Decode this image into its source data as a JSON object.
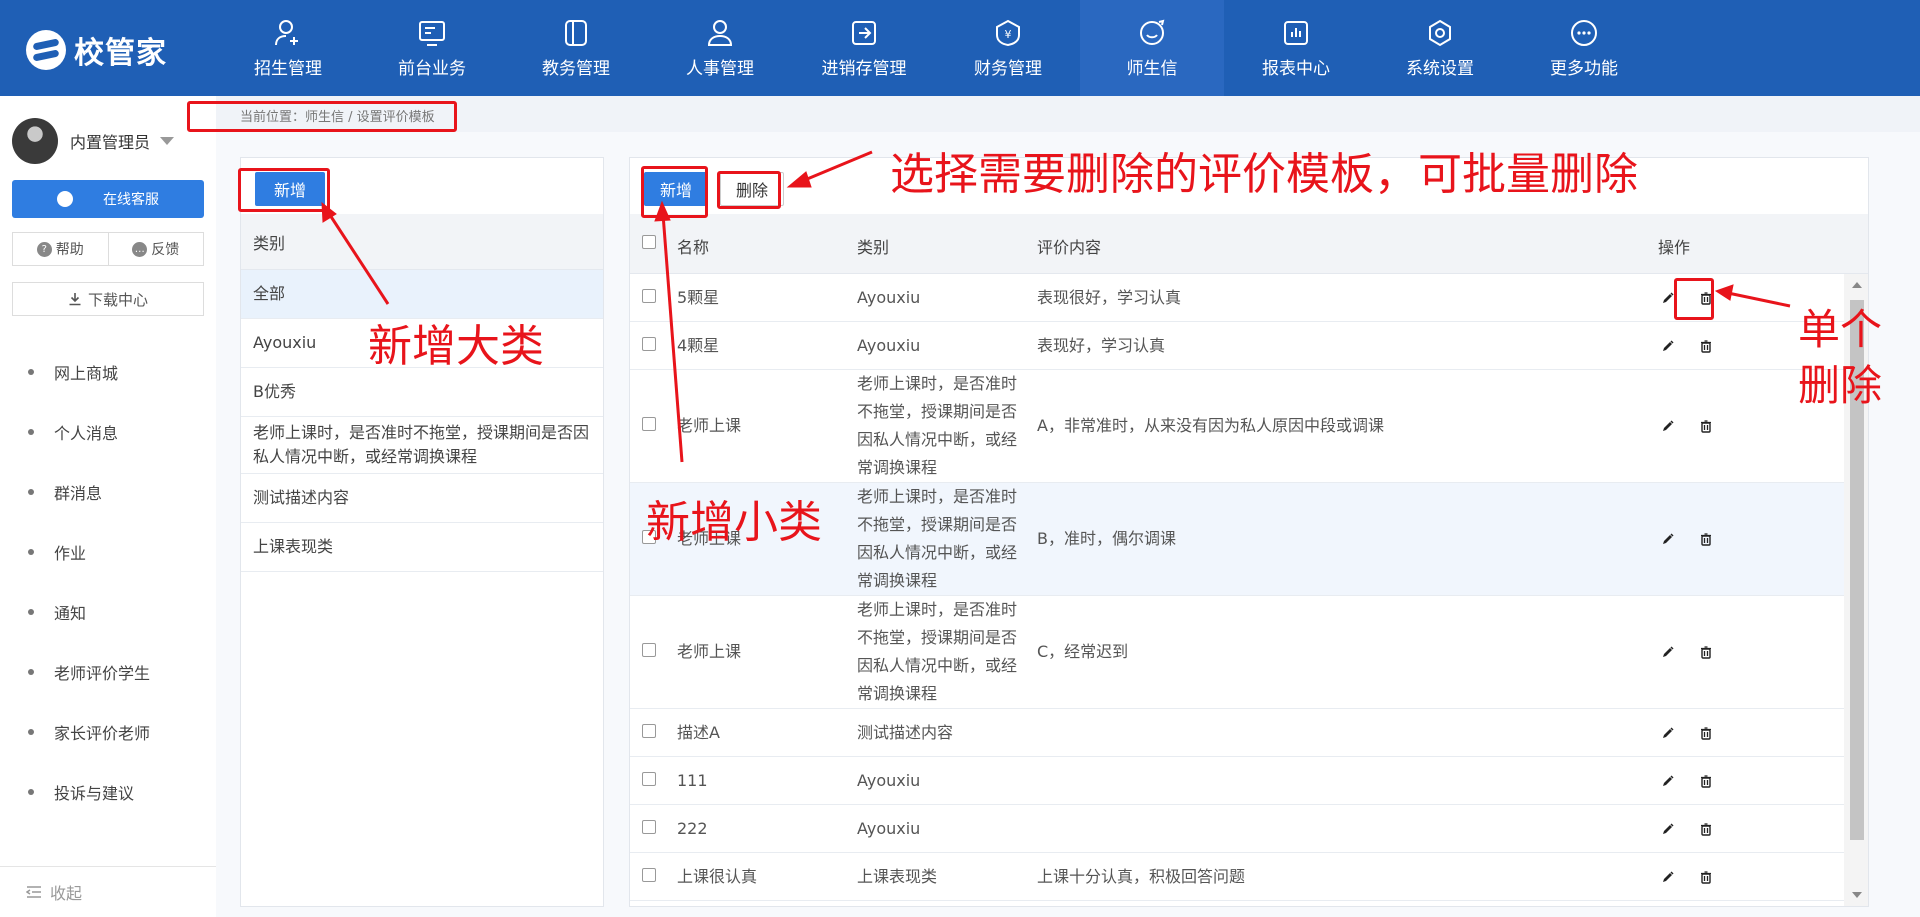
{
  "brand": {
    "name": "校管家"
  },
  "nav": [
    {
      "label": "招生管理",
      "icon": "user-plus-icon"
    },
    {
      "label": "前台业务",
      "icon": "monitor-icon"
    },
    {
      "label": "教务管理",
      "icon": "book-icon"
    },
    {
      "label": "人事管理",
      "icon": "person-icon"
    },
    {
      "label": "进销存管理",
      "icon": "arrow-box-icon"
    },
    {
      "label": "财务管理",
      "icon": "yen-shield-icon"
    },
    {
      "label": "师生信",
      "icon": "chat-icon"
    },
    {
      "label": "报表中心",
      "icon": "report-icon"
    },
    {
      "label": "系统设置",
      "icon": "gear-icon"
    },
    {
      "label": "更多功能",
      "icon": "more-icon"
    }
  ],
  "nav_active": 6,
  "sidebar": {
    "user_name": "内置管理员",
    "service_label": "在线客服",
    "help_label": "帮助",
    "feedback_label": "反馈",
    "download_label": "下载中心",
    "menu": [
      "网上商城",
      "个人消息",
      "群消息",
      "作业",
      "通知",
      "老师评价学生",
      "家长评价老师",
      "投诉与建议"
    ],
    "collapse_label": "收起"
  },
  "breadcrumb": "当前位置：师生信 / 设置评价模板",
  "category_panel": {
    "add_label": "新增",
    "header": "类别",
    "items": [
      {
        "label": "全部",
        "selected": true
      },
      {
        "label": "Ayouxiu"
      },
      {
        "label": "B优秀"
      },
      {
        "label": "老师上课时，是否准时不拖堂，授课期间是否因私人情况中断，或经常调换课程"
      },
      {
        "label": "测试描述内容"
      },
      {
        "label": "上课表现类"
      }
    ]
  },
  "template_panel": {
    "add_label": "新增",
    "delete_label": "删除",
    "columns": {
      "name": "名称",
      "category": "类别",
      "content": "评价内容",
      "ops": "操作"
    },
    "rows": [
      {
        "name": "5颗星",
        "category": "Ayouxiu",
        "content": "表现很好，学习认真",
        "height": 48
      },
      {
        "name": "4颗星",
        "category": "Ayouxiu",
        "content": "表现好，学习认真",
        "height": 48
      },
      {
        "name": "老师上课",
        "category": "老师上课时，是否准时不拖堂，授课期间是否因私人情况中断，或经常调换课程",
        "content": "A，非常准时，从来没有因为私人原因中段或调课",
        "height": 113
      },
      {
        "name": "老师上课",
        "category": "老师上课时，是否准时不拖堂，授课期间是否因私人情况中断，或经常调换课程",
        "content": "B，准时，偶尔调课",
        "height": 113,
        "highlight": true
      },
      {
        "name": "老师上课",
        "category": "老师上课时，是否准时不拖堂，授课期间是否因私人情况中断，或经常调换课程",
        "content": "C，经常迟到",
        "height": 113
      },
      {
        "name": "描述A",
        "category": "测试描述内容",
        "content": "",
        "height": 48
      },
      {
        "name": "111",
        "category": "Ayouxiu",
        "content": "",
        "height": 48
      },
      {
        "name": "222",
        "category": "Ayouxiu",
        "content": "",
        "height": 48
      },
      {
        "name": "上课很认真",
        "category": "上课表现类",
        "content": "上课十分认真，积极回答问题",
        "height": 48
      }
    ]
  },
  "annotations": {
    "batch_delete": "选择需要删除的评价模板，可批量删除",
    "add_major": "新增大类",
    "add_minor": "新增小类",
    "single_delete_line1": "单个",
    "single_delete_line2": "删除",
    "color": "#e8141b"
  },
  "colors": {
    "topbar": "#1f5fb5",
    "primary": "#2f7de1"
  }
}
